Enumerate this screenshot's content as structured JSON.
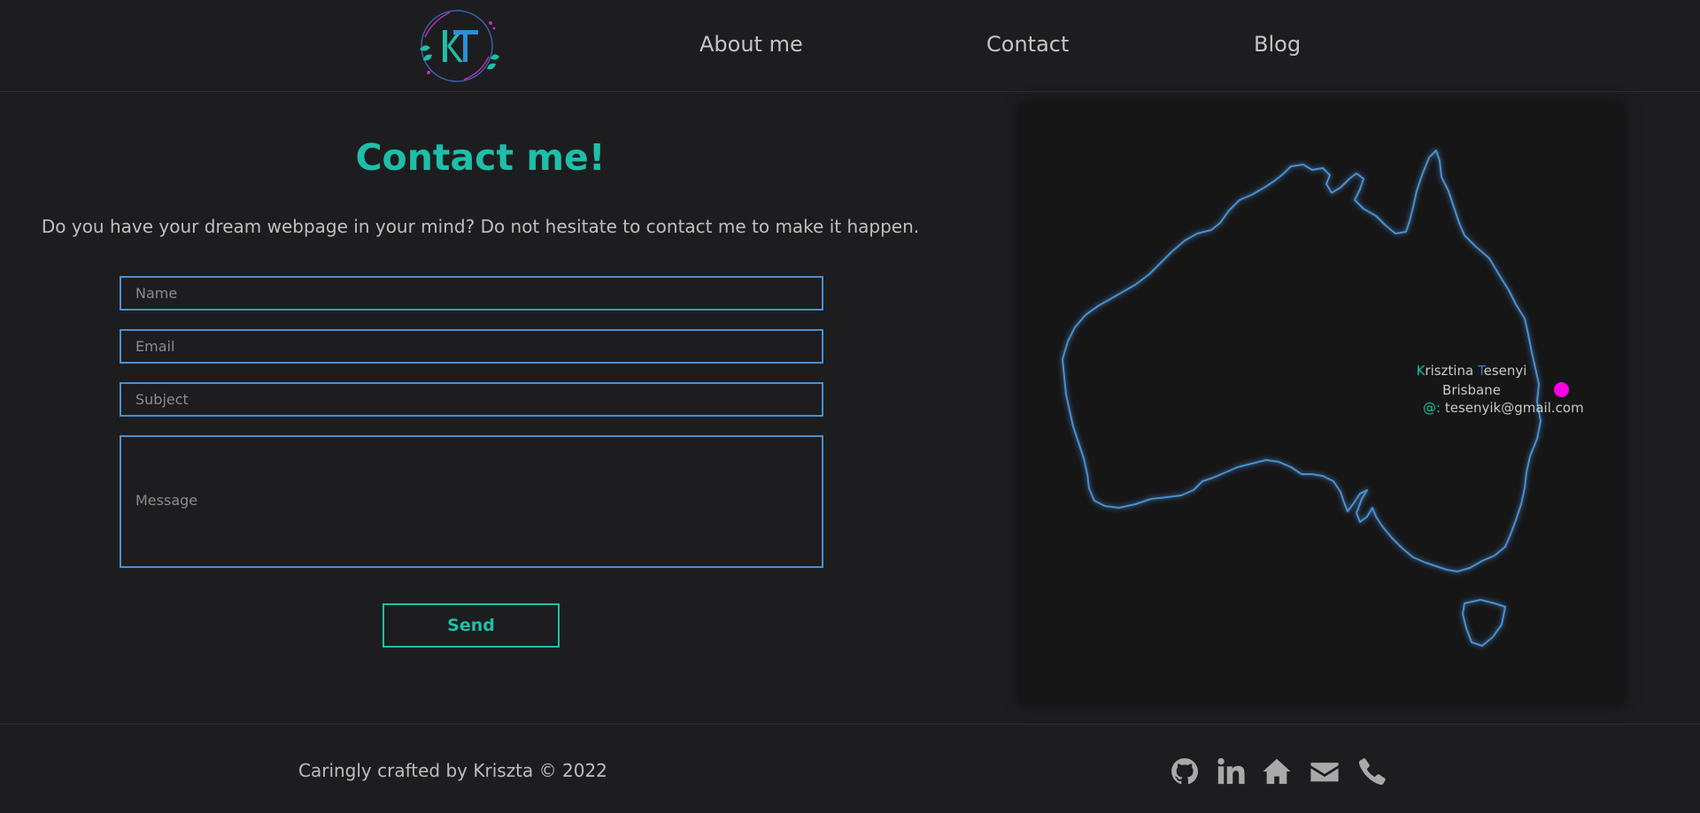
{
  "header": {
    "logo_icon": "kt-monogram-logo",
    "nav": [
      {
        "label": "About me"
      },
      {
        "label": "Contact"
      },
      {
        "label": "Blog"
      }
    ]
  },
  "contact": {
    "title": "Contact me!",
    "intro": "Do you have your dream webpage in your mind? Do not hesitate to contact me to make it happen.",
    "fields": {
      "name": {
        "placeholder": "Name",
        "value": ""
      },
      "email": {
        "placeholder": "Email",
        "value": ""
      },
      "subject": {
        "placeholder": "Subject",
        "value": ""
      },
      "message": {
        "placeholder": "Message",
        "value": ""
      }
    },
    "send_label": "Send"
  },
  "map": {
    "region": "australia-outline",
    "name_first_initial": "K",
    "name_first_rest": "risztina",
    "name_last_initial": "T",
    "name_last_rest": "esenyi",
    "city": "Brisbane",
    "email_prefix": "@:",
    "email": "tesenyik@gmail.com"
  },
  "footer": {
    "credit": "Caringly crafted by Kriszta © 2022",
    "icons": [
      "github-icon",
      "linkedin-icon",
      "home-icon",
      "mail-icon",
      "phone-icon"
    ]
  },
  "colors": {
    "background": "#1d1d1f",
    "accent_teal": "#1dbfa8",
    "accent_blue": "#4a8fd0",
    "location_dot": "#ff00e0"
  }
}
